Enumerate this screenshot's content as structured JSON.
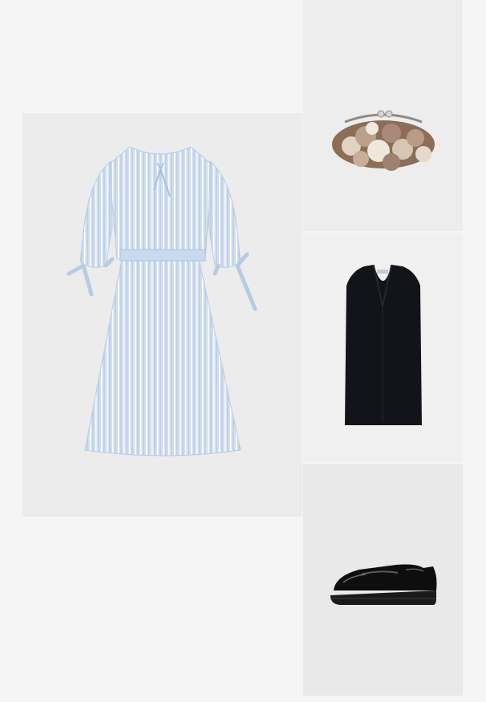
{
  "outfit": {
    "items": [
      {
        "id": "dress",
        "icon": "striped-dress-image",
        "color": "#c9d9ee"
      },
      {
        "id": "clutch",
        "icon": "floral-clutch-image",
        "color": "#a88e78"
      },
      {
        "id": "vest",
        "icon": "black-vest-image",
        "color": "#111318"
      },
      {
        "id": "loafer",
        "icon": "black-loafer-image",
        "color": "#0e0e0e"
      }
    ]
  }
}
